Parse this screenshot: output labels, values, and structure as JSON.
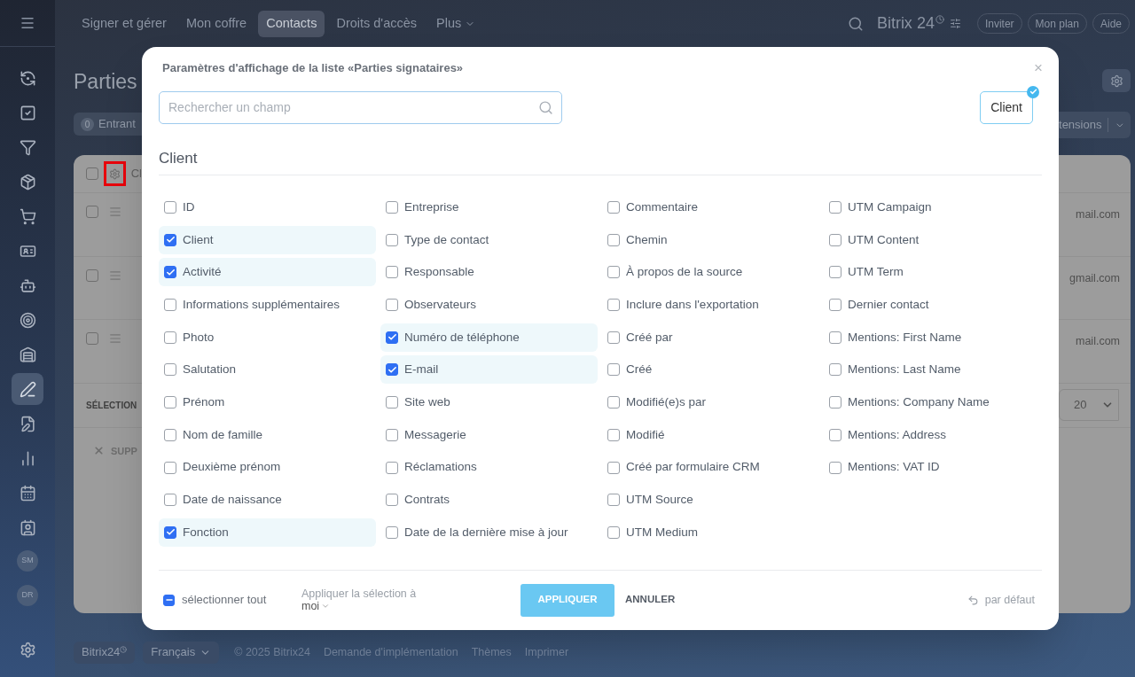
{
  "sidebar": {
    "items": [
      {
        "selected": false
      },
      {
        "selected": false
      },
      {
        "selected": false
      },
      {
        "selected": false
      },
      {
        "selected": false
      },
      {
        "selected": false
      },
      {
        "selected": false
      },
      {
        "selected": false
      },
      {
        "selected": false
      },
      {
        "selected": true
      },
      {
        "selected": false
      },
      {
        "selected": false
      },
      {
        "selected": false
      },
      {
        "selected": false
      }
    ],
    "avatars": [
      {
        "initials": "SM"
      },
      {
        "initials": "DR"
      }
    ]
  },
  "top_nav": {
    "tabs": [
      {
        "label": "Signer et gérer",
        "selected": false
      },
      {
        "label": "Mon coffre",
        "selected": false
      },
      {
        "label": "Contacts",
        "selected": true
      },
      {
        "label": "Droits d'accès",
        "selected": false
      },
      {
        "label": "Plus",
        "selected": false,
        "kind": "menu"
      }
    ],
    "logo": "Bitrix 24",
    "buttons": [
      "Inviter",
      "Mon plan",
      "Aide"
    ]
  },
  "page": {
    "title": "Parties",
    "counter": {
      "count": "0",
      "label": "Entrant"
    },
    "extensions_button": "tensions",
    "table_header": "Cl",
    "header_checked": false,
    "rows": [
      {
        "email": "mail.com",
        "checked": false
      },
      {
        "email": "gmail.com",
        "checked": false
      },
      {
        "email": "mail.com",
        "checked": false
      }
    ],
    "selection_label": "SÉLECTION",
    "delete_action": "SUPP",
    "page_size": "20"
  },
  "dialog": {
    "title": "Paramètres d'affichage de la liste «Parties signataires»",
    "close": "×",
    "search": {
      "placeholder": "Rechercher un champ"
    },
    "section_chips": [
      {
        "label": "Client",
        "selected": true
      }
    ],
    "section_title": "Client",
    "columns": [
      {
        "fields": [
          {
            "label": "ID",
            "checked": false
          },
          {
            "label": "Client",
            "checked": true
          },
          {
            "label": "Activité",
            "checked": true
          },
          {
            "label": "Informations supplémentaires",
            "checked": false
          },
          {
            "label": "Photo",
            "checked": false
          },
          {
            "label": "Salutation",
            "checked": false
          },
          {
            "label": "Prénom",
            "checked": false
          },
          {
            "label": "Nom de famille",
            "checked": false
          },
          {
            "label": "Deuxième prénom",
            "checked": false
          },
          {
            "label": "Date de naissance",
            "checked": false
          },
          {
            "label": "Fonction",
            "checked": true
          }
        ]
      },
      {
        "fields": [
          {
            "label": "Entreprise",
            "checked": false
          },
          {
            "label": "Type de contact",
            "checked": false
          },
          {
            "label": "Responsable",
            "checked": false
          },
          {
            "label": "Observateurs",
            "checked": false
          },
          {
            "label": "Numéro de téléphone",
            "checked": true
          },
          {
            "label": "E-mail",
            "checked": true
          },
          {
            "label": "Site web",
            "checked": false
          },
          {
            "label": "Messagerie",
            "checked": false
          },
          {
            "label": "Réclamations",
            "checked": false
          },
          {
            "label": "Contrats",
            "checked": false
          },
          {
            "label": "Date de la dernière mise à jour",
            "checked": false
          }
        ]
      },
      {
        "fields": [
          {
            "label": "Commentaire",
            "checked": false
          },
          {
            "label": "Chemin",
            "checked": false
          },
          {
            "label": "À propos de la source",
            "checked": false
          },
          {
            "label": "Inclure dans l'exportation",
            "checked": false
          },
          {
            "label": "Créé par",
            "checked": false
          },
          {
            "label": "Créé",
            "checked": false
          },
          {
            "label": "Modifié(e)s par",
            "checked": false
          },
          {
            "label": "Modifié",
            "checked": false
          },
          {
            "label": "Créé par formulaire CRM",
            "checked": false
          },
          {
            "label": "UTM Source",
            "checked": false
          },
          {
            "label": "UTM Medium",
            "checked": false
          }
        ]
      },
      {
        "fields": [
          {
            "label": "UTM Campaign",
            "checked": false
          },
          {
            "label": "UTM Content",
            "checked": false
          },
          {
            "label": "UTM Term",
            "checked": false
          },
          {
            "label": "Dernier contact",
            "checked": false
          },
          {
            "label": "Mentions: First Name",
            "checked": false
          },
          {
            "label": "Mentions: Last Name",
            "checked": false
          },
          {
            "label": "Mentions: Company Name",
            "checked": false
          },
          {
            "label": "Mentions: Address",
            "checked": false
          },
          {
            "label": "Mentions: VAT ID",
            "checked": false
          }
        ]
      }
    ],
    "select_all": {
      "label": "sélectionner tout",
      "indeterminate": true
    },
    "apply_to": {
      "label": "Appliquer la sélection à",
      "value": "moi"
    },
    "apply_button": "APPLIQUER",
    "cancel_button": "ANNULER",
    "reset": "par défaut"
  },
  "footer": {
    "logo": "Bitrix24",
    "language": "Français",
    "links": [
      "© 2025 Bitrix24",
      "Demande d'implémentation",
      "Thèmes",
      "Imprimer"
    ]
  }
}
